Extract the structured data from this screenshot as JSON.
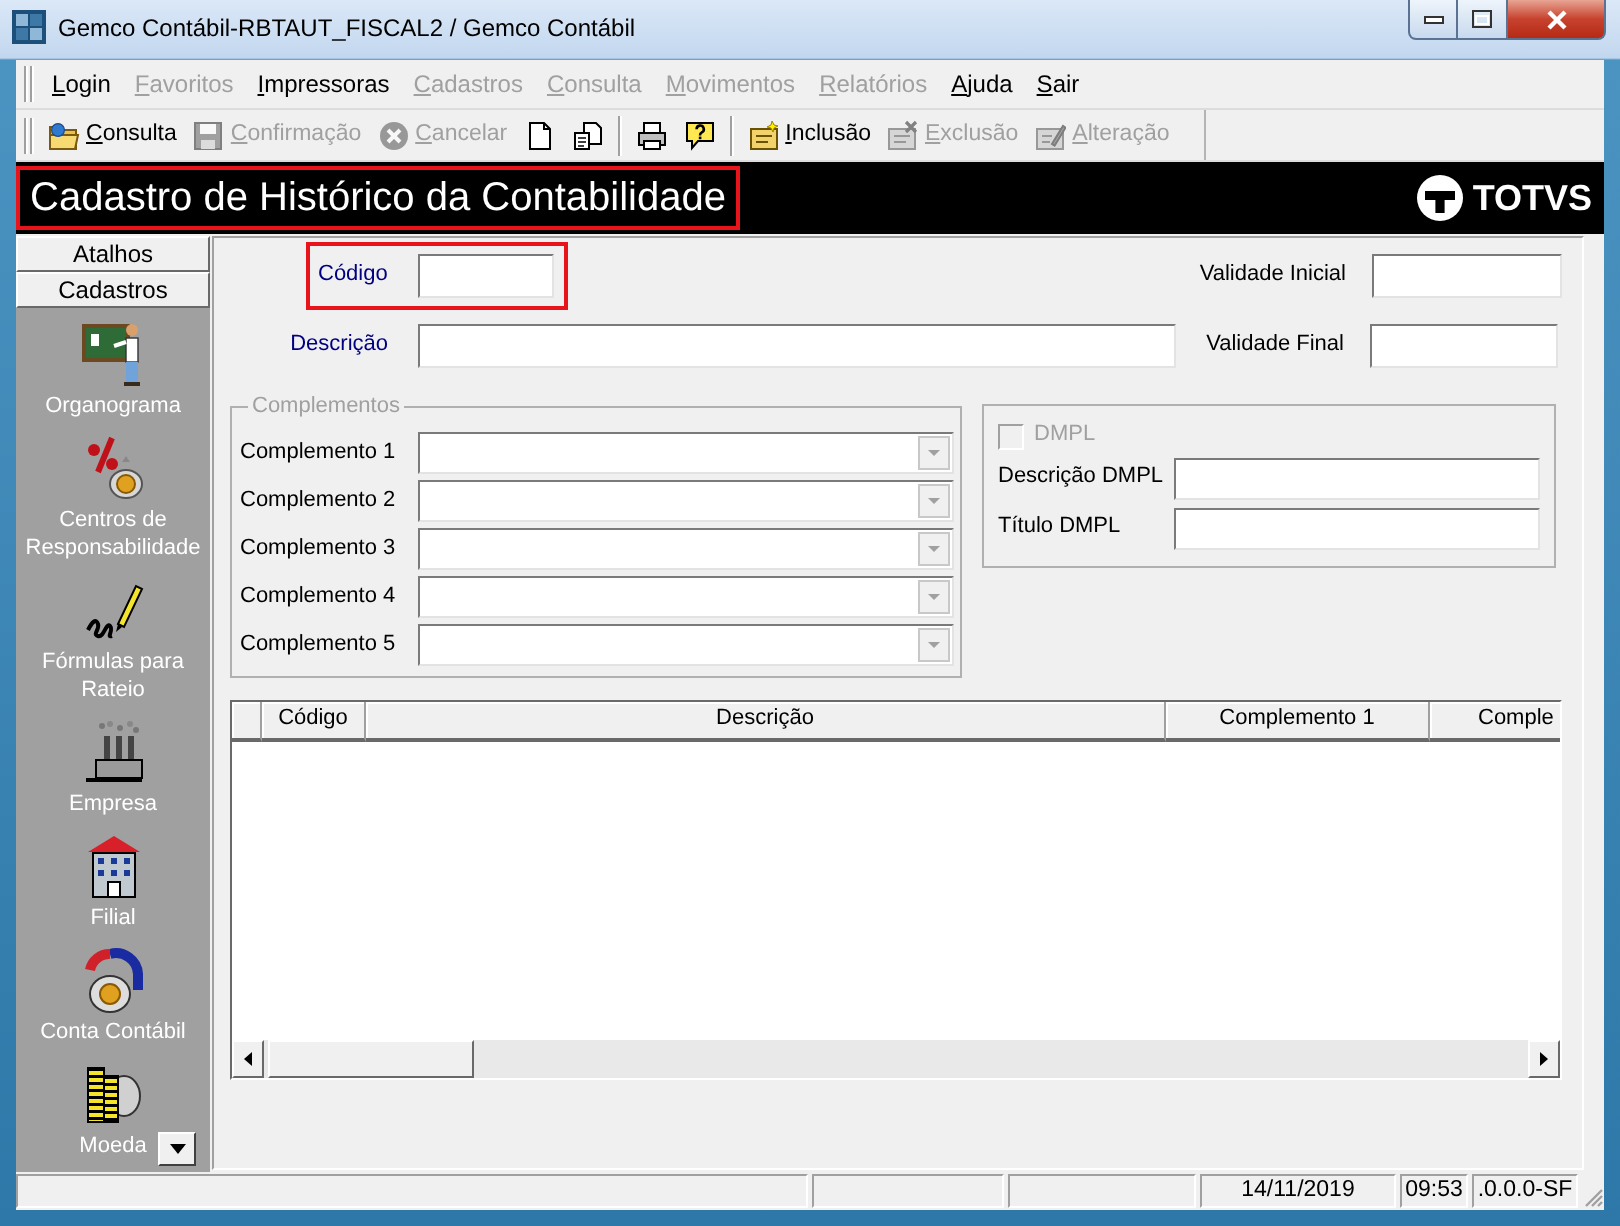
{
  "window": {
    "title": "Gemco Contábil-RBTAUT_FISCAL2 / Gemco Contábil"
  },
  "menu": [
    {
      "label": "Login",
      "disabled": false
    },
    {
      "label": "Favoritos",
      "disabled": true
    },
    {
      "label": "Impressoras",
      "disabled": false
    },
    {
      "label": "Cadastros",
      "disabled": true
    },
    {
      "label": "Consulta",
      "disabled": true
    },
    {
      "label": "Movimentos",
      "disabled": true
    },
    {
      "label": "Relatórios",
      "disabled": true
    },
    {
      "label": "Ajuda",
      "disabled": false
    },
    {
      "label": "Sair",
      "disabled": false
    }
  ],
  "toolbar": [
    {
      "kind": "button",
      "label": "Consulta",
      "disabled": false
    },
    {
      "kind": "button",
      "label": "Confirmação",
      "disabled": true
    },
    {
      "kind": "button",
      "label": "Cancelar",
      "disabled": true
    },
    {
      "kind": "icon"
    },
    {
      "kind": "icon"
    },
    {
      "kind": "separator"
    },
    {
      "kind": "icon"
    },
    {
      "kind": "icon"
    },
    {
      "kind": "separator"
    },
    {
      "kind": "button",
      "label": "Inclusão",
      "disabled": false
    },
    {
      "kind": "button",
      "label": "Exclusão",
      "disabled": true
    },
    {
      "kind": "button",
      "label": "Alteração",
      "disabled": true
    }
  ],
  "header": {
    "title": "Cadastro de Histórico da Contabilidade",
    "highlighted": true,
    "logo": "TOTVS"
  },
  "sidebar": {
    "groups": [
      {
        "label": "Atalhos"
      },
      {
        "label": "Cadastros"
      }
    ],
    "items": [
      {
        "label": "Organograma"
      },
      {
        "label": "Centros de Responsabilidade"
      },
      {
        "label": "Fórmulas para Rateio"
      },
      {
        "label": "Empresa"
      },
      {
        "label": "Filial"
      },
      {
        "label": "Conta Contábil"
      },
      {
        "label": "Moeda"
      }
    ]
  },
  "form": {
    "fields": [
      {
        "label": "Código",
        "required": true,
        "highlighted": true
      },
      {
        "label": "Validade Inicial",
        "required": false,
        "highlighted": false
      },
      {
        "label": "Descrição",
        "required": true,
        "highlighted": false
      },
      {
        "label": "Validade Final",
        "required": false,
        "highlighted": false
      }
    ]
  },
  "complementos": {
    "title": "Complementos",
    "disabled": true,
    "rows": [
      {
        "label": "Complemento 1"
      },
      {
        "label": "Complemento 2"
      },
      {
        "label": "Complemento 3"
      },
      {
        "label": "Complemento 4"
      },
      {
        "label": "Complemento 5"
      }
    ]
  },
  "dmpl": {
    "checkbox": {
      "label": "DMPL",
      "checked": false,
      "disabled": true
    },
    "fields": [
      {
        "label": "Descrição DMPL"
      },
      {
        "label": "Título DMPL"
      }
    ]
  },
  "grid": {
    "columns": [
      {
        "label": "Código"
      },
      {
        "label": "Descrição"
      },
      {
        "label": "Complemento 1"
      },
      {
        "label": "Comple"
      }
    ]
  },
  "status_bar": {
    "panels": [
      {
        "kind": "blank"
      },
      {
        "kind": "blank"
      },
      {
        "kind": "blank"
      },
      {
        "kind": "text",
        "text": "14/11/2019"
      },
      {
        "kind": "text",
        "text": "09:53"
      },
      {
        "kind": "text",
        "text": ".0.0.0-SF"
      }
    ]
  }
}
